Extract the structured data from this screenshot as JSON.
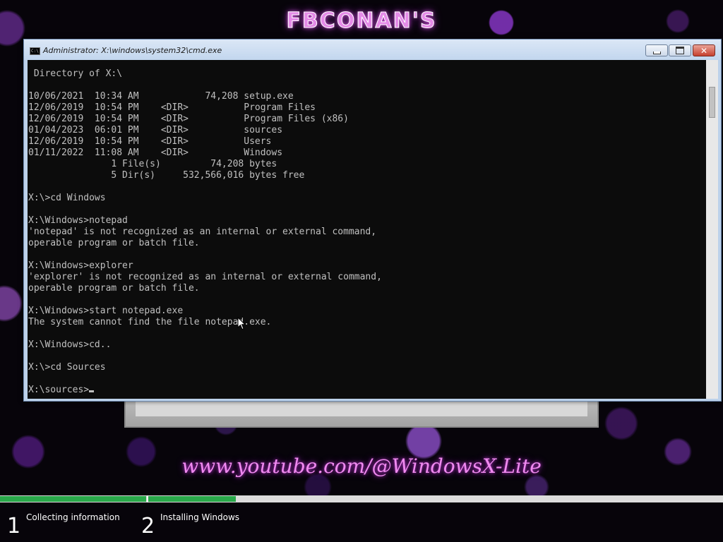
{
  "branding": {
    "top_title": "FBCONAN'S",
    "youtube_text": "www.youtube.com/@WindowsX-Lite"
  },
  "cmd": {
    "title": "Administrator: X:\\windows\\system32\\cmd.exe",
    "icon": "cmd-icon",
    "controls": {
      "minimize": "minimize-icon",
      "maximize": "maximize-icon",
      "close": "close-icon"
    },
    "console_lines": [
      " Directory of X:\\",
      "",
      "10/06/2021  10:34 AM            74,208 setup.exe",
      "12/06/2019  10:54 PM    <DIR>          Program Files",
      "12/06/2019  10:54 PM    <DIR>          Program Files (x86)",
      "01/04/2023  06:01 PM    <DIR>          sources",
      "12/06/2019  10:54 PM    <DIR>          Users",
      "01/11/2022  11:08 AM    <DIR>          Windows",
      "               1 File(s)         74,208 bytes",
      "               5 Dir(s)     532,566,016 bytes free",
      "",
      "X:\\>cd Windows",
      "",
      "X:\\Windows>notepad",
      "'notepad' is not recognized as an internal or external command,",
      "operable program or batch file.",
      "",
      "X:\\Windows>explorer",
      "'explorer' is not recognized as an internal or external command,",
      "operable program or batch file.",
      "",
      "X:\\Windows>start notepad.exe",
      "The system cannot find the file notepad.exe.",
      "",
      "X:\\Windows>cd..",
      "",
      "X:\\>cd Sources",
      ""
    ],
    "prompt": "X:\\sources>"
  },
  "progress": {
    "steps": [
      {
        "number": "1",
        "label": "Collecting information"
      },
      {
        "number": "2",
        "label": "Installing Windows"
      }
    ],
    "color": "#29a84a"
  }
}
